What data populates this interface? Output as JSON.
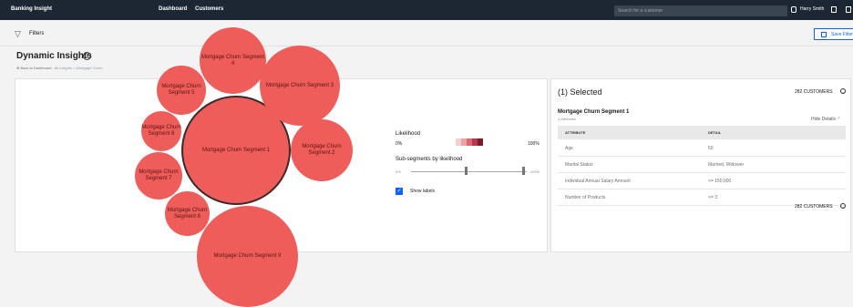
{
  "app": {
    "name": "Banking Insight",
    "nav": [
      "Dashboard",
      "Customers"
    ],
    "search_placeholder": "Search for a customer",
    "user": "Harry Smith"
  },
  "filter_bar": {
    "label": "Filters",
    "save_label": "Save Filter"
  },
  "page": {
    "title": "Dynamic Insights",
    "breadcrumb_back": "Back to Dashboard",
    "breadcrumb_path": "All Insights > Mortgage Churn"
  },
  "bubbles": [
    "Mortgage Churn Segment 1",
    "Mortgage Churn Segment 2",
    "Mortgage Churn Segment 3",
    "Mortgage Churn Segment 4",
    "Mortgage Churn Segment 5",
    "Mortgage Churn Segment 6",
    "Mortgage Churn Segment 7",
    "Mortgage Churn Segment 8",
    "Mortgage Churn Segment 9"
  ],
  "bubble_color": "#ee5d5a",
  "legend": {
    "likelihood_label": "Likelihood",
    "min": "0%",
    "max": "100%",
    "swatches": [
      "#f4cfcf",
      "#eba3a6",
      "#d96a73",
      "#b23a4a",
      "#7a1a2a"
    ]
  },
  "sub_segments": {
    "label": "Sub-segments by likelihood",
    "min": "0%",
    "max": "100%"
  },
  "show_labels": {
    "label": "Show labels",
    "checked": true
  },
  "side_panel": {
    "title": "(1) Selected",
    "customers": "282 CUSTOMERS",
    "segment_name": "Mortgage Churn Segment 1",
    "attributes_count": "4 Attributes",
    "hide_details": "Hide Details",
    "col_attribute": "ATTRIBUTE",
    "col_detail": "DETAIL",
    "rows": [
      {
        "attribute": "Age",
        "detail": "50"
      },
      {
        "attribute": "Marital Status",
        "detail": "Married, Widower"
      },
      {
        "attribute": "Individual Annual Salary Amount",
        "detail": "<= 150,000"
      },
      {
        "attribute": "Number of Products",
        "detail": "<= 3"
      }
    ],
    "footer_customers": "282 CUSTOMERS"
  }
}
